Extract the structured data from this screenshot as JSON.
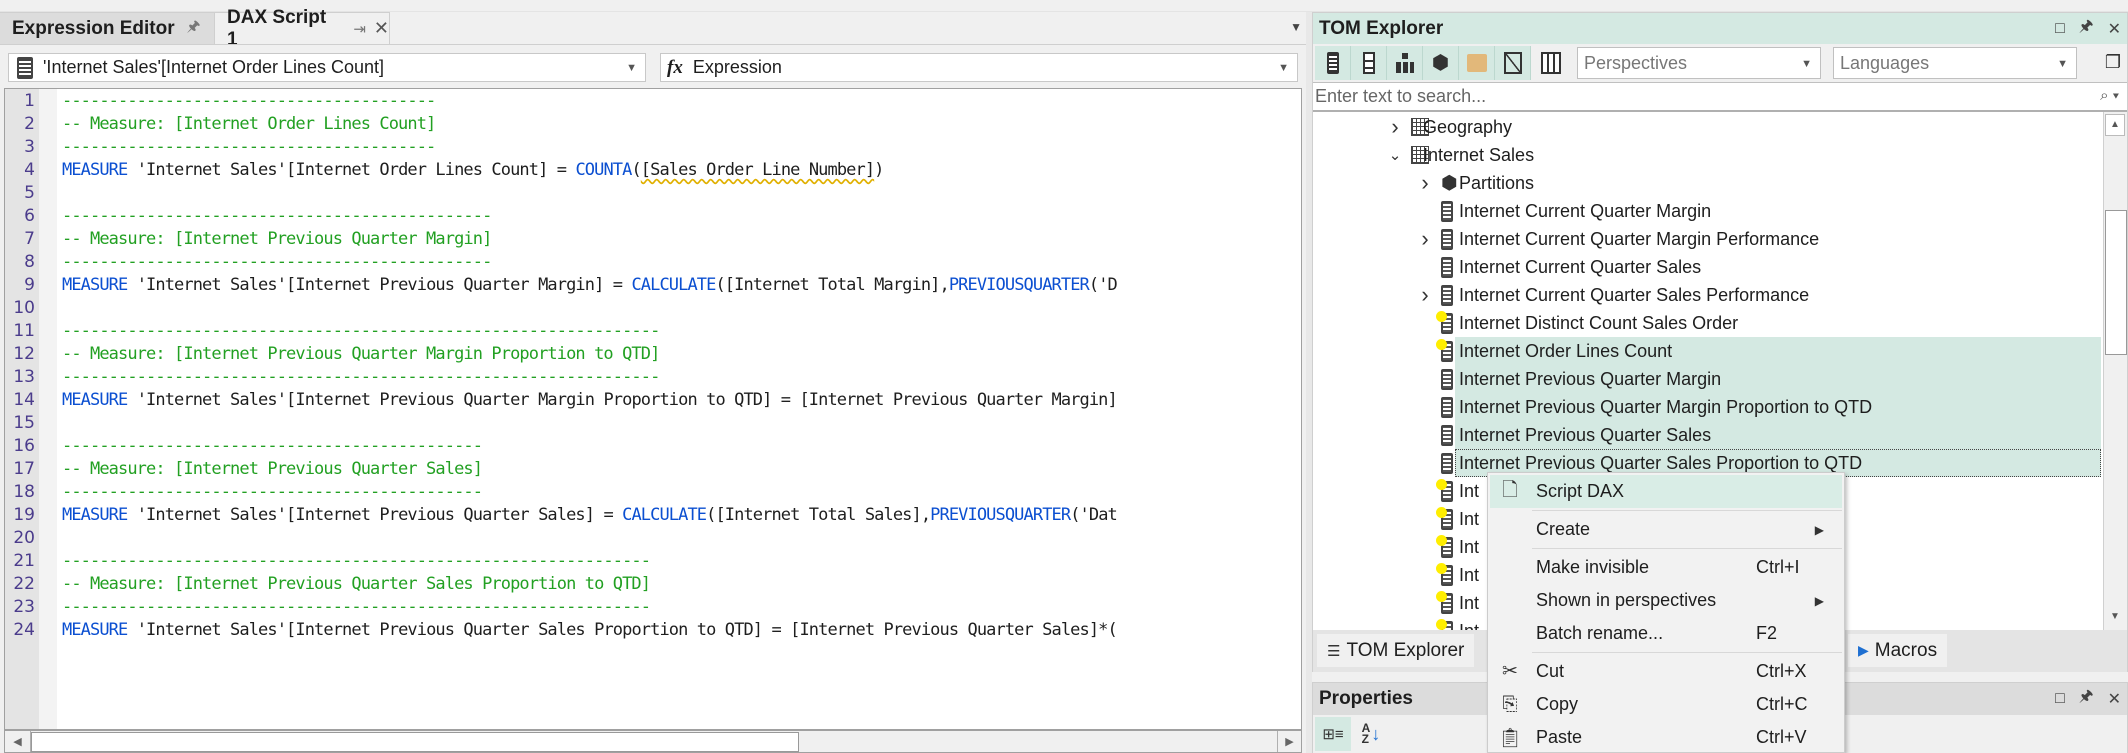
{
  "document_tabs": [
    {
      "label": "Expression Editor",
      "active": false,
      "pin_icon": "pin-icon"
    },
    {
      "label": "DAX Script 1",
      "active": true,
      "pin_icon": "pin-sideways-icon",
      "close_icon": "close-icon"
    }
  ],
  "selectors": {
    "object": "'Internet Sales'[Internet Order Lines Count]",
    "property_icon": "fx",
    "property": "Expression"
  },
  "code": {
    "lines": [
      {
        "n": "1",
        "parts": [
          {
            "t": "----------------------------------------",
            "c": "comment"
          }
        ]
      },
      {
        "n": "2",
        "parts": [
          {
            "t": "-- Measure: [Internet Order Lines Count]",
            "c": "comment"
          }
        ]
      },
      {
        "n": "3",
        "parts": [
          {
            "t": "----------------------------------------",
            "c": "comment"
          }
        ]
      },
      {
        "n": "4",
        "parts": [
          {
            "t": "MEASURE",
            "c": "kw"
          },
          {
            "t": " 'Internet Sales'[Internet Order Lines Count] = ",
            "c": ""
          },
          {
            "t": "COUNTA",
            "c": "fn"
          },
          {
            "t": "(",
            "c": ""
          },
          {
            "t": "[Sales Order Line Number]",
            "c": "squig"
          },
          {
            "t": ")",
            "c": ""
          }
        ]
      },
      {
        "n": "5",
        "parts": []
      },
      {
        "n": "6",
        "parts": [
          {
            "t": "----------------------------------------------",
            "c": "comment"
          }
        ]
      },
      {
        "n": "7",
        "parts": [
          {
            "t": "-- Measure: [Internet Previous Quarter Margin]",
            "c": "comment"
          }
        ]
      },
      {
        "n": "8",
        "parts": [
          {
            "t": "----------------------------------------------",
            "c": "comment"
          }
        ]
      },
      {
        "n": "9",
        "parts": [
          {
            "t": "MEASURE",
            "c": "kw"
          },
          {
            "t": " 'Internet Sales'[Internet Previous Quarter Margin] = ",
            "c": ""
          },
          {
            "t": "CALCULATE",
            "c": "fn"
          },
          {
            "t": "([Internet Total Margin],",
            "c": ""
          },
          {
            "t": "PREVIOUSQUARTER",
            "c": "fn"
          },
          {
            "t": "('D",
            "c": ""
          }
        ]
      },
      {
        "n": "10",
        "parts": []
      },
      {
        "n": "11",
        "parts": [
          {
            "t": "----------------------------------------------------------------",
            "c": "comment"
          }
        ]
      },
      {
        "n": "12",
        "parts": [
          {
            "t": "-- Measure: [Internet Previous Quarter Margin Proportion to QTD]",
            "c": "comment"
          }
        ]
      },
      {
        "n": "13",
        "parts": [
          {
            "t": "----------------------------------------------------------------",
            "c": "comment"
          }
        ]
      },
      {
        "n": "14",
        "parts": [
          {
            "t": "MEASURE",
            "c": "kw"
          },
          {
            "t": " 'Internet Sales'[Internet Previous Quarter Margin Proportion to QTD] = [Internet Previous Quarter Margin]",
            "c": ""
          }
        ]
      },
      {
        "n": "15",
        "parts": []
      },
      {
        "n": "16",
        "parts": [
          {
            "t": "---------------------------------------------",
            "c": "comment"
          }
        ]
      },
      {
        "n": "17",
        "parts": [
          {
            "t": "-- Measure: [Internet Previous Quarter Sales]",
            "c": "comment"
          }
        ]
      },
      {
        "n": "18",
        "parts": [
          {
            "t": "---------------------------------------------",
            "c": "comment"
          }
        ]
      },
      {
        "n": "19",
        "parts": [
          {
            "t": "MEASURE",
            "c": "kw"
          },
          {
            "t": " 'Internet Sales'[Internet Previous Quarter Sales] = ",
            "c": ""
          },
          {
            "t": "CALCULATE",
            "c": "fn"
          },
          {
            "t": "([Internet Total Sales],",
            "c": ""
          },
          {
            "t": "PREVIOUSQUARTER",
            "c": "fn"
          },
          {
            "t": "('Dat",
            "c": ""
          }
        ]
      },
      {
        "n": "20",
        "parts": []
      },
      {
        "n": "21",
        "parts": [
          {
            "t": "---------------------------------------------------------------",
            "c": "comment"
          }
        ]
      },
      {
        "n": "22",
        "parts": [
          {
            "t": "-- Measure: [Internet Previous Quarter Sales Proportion to QTD]",
            "c": "comment"
          }
        ]
      },
      {
        "n": "23",
        "parts": [
          {
            "t": "---------------------------------------------------------------",
            "c": "comment"
          }
        ]
      },
      {
        "n": "24",
        "parts": [
          {
            "t": "MEASURE",
            "c": "kw"
          },
          {
            "t": " 'Internet Sales'[Internet Previous Quarter Sales Proportion to QTD] = [Internet Previous Quarter Sales]*(",
            "c": ""
          }
        ]
      }
    ]
  },
  "tom_explorer": {
    "title": "TOM Explorer",
    "window_controls": [
      "maximize-icon",
      "pin-icon",
      "close-icon"
    ],
    "toolbar_buttons": [
      {
        "name": "show-measures",
        "icon": "calculator-icon",
        "on": true
      },
      {
        "name": "show-columns",
        "icon": "column-icon",
        "on": true
      },
      {
        "name": "show-hierarchies",
        "icon": "hierarchy-icon",
        "on": true
      },
      {
        "name": "show-partitions",
        "icon": "cube-icon",
        "on": true
      },
      {
        "name": "display-folders",
        "icon": "folder-icon",
        "on": true
      },
      {
        "name": "show-hidden",
        "icon": "hidden-icon",
        "on": true
      },
      {
        "name": "show-all-columns",
        "icon": "columns-icon",
        "on": false
      }
    ],
    "perspectives_placeholder": "Perspectives",
    "languages_placeholder": "Languages",
    "search_placeholder": "Enter text to search...",
    "tree": [
      {
        "label": "Geography",
        "level": 0,
        "icon": "table",
        "chevron": "collapsed"
      },
      {
        "label": "Internet Sales",
        "level": 0,
        "icon": "table",
        "chevron": "expanded"
      },
      {
        "label": "Partitions",
        "level": 1,
        "icon": "partition",
        "chevron": "collapsed"
      },
      {
        "label": "Internet Current Quarter Margin",
        "level": 1,
        "icon": "measure",
        "chevron": "none"
      },
      {
        "label": "Internet Current Quarter Margin Performance",
        "level": 1,
        "icon": "measure",
        "chevron": "collapsed"
      },
      {
        "label": "Internet Current Quarter Sales",
        "level": 1,
        "icon": "measure",
        "chevron": "none"
      },
      {
        "label": "Internet Current Quarter Sales Performance",
        "level": 1,
        "icon": "measure",
        "chevron": "collapsed"
      },
      {
        "label": "Internet Distinct Count Sales Order",
        "level": 1,
        "icon": "measure",
        "chevron": "none",
        "warning": true
      },
      {
        "label": "Internet Order Lines Count",
        "level": 1,
        "icon": "measure",
        "chevron": "none",
        "warning": true,
        "selected": true
      },
      {
        "label": "Internet Previous Quarter Margin",
        "level": 1,
        "icon": "measure",
        "chevron": "none",
        "selected": true
      },
      {
        "label": "Internet Previous Quarter Margin Proportion to QTD",
        "level": 1,
        "icon": "measure",
        "chevron": "none",
        "selected": true
      },
      {
        "label": "Internet Previous Quarter Sales",
        "level": 1,
        "icon": "measure",
        "chevron": "none",
        "selected": true
      },
      {
        "label": "Internet Previous Quarter Sales Proportion to QTD",
        "level": 1,
        "icon": "measure",
        "chevron": "none",
        "selected": true,
        "focused": true
      },
      {
        "label": "Int",
        "level": 1,
        "icon": "measure",
        "chevron": "none",
        "warning": true
      },
      {
        "label": "Int",
        "level": 1,
        "icon": "measure",
        "chevron": "none",
        "warning": true
      },
      {
        "label": "Int",
        "level": 1,
        "icon": "measure",
        "chevron": "none",
        "warning": true
      },
      {
        "label": "Int",
        "level": 1,
        "icon": "measure",
        "chevron": "none",
        "warning": true
      },
      {
        "label": "Int",
        "level": 1,
        "icon": "measure",
        "chevron": "none",
        "warning": true
      },
      {
        "label": "Int",
        "level": 1,
        "icon": "measure",
        "chevron": "none",
        "warning": true
      }
    ],
    "bottom_tabs": [
      {
        "label": "TOM Explorer",
        "icon": "tree-list-icon"
      },
      {
        "label": "Macros",
        "icon": "macro-play-icon"
      }
    ]
  },
  "properties": {
    "title": "Properties",
    "window_controls": [
      "maximize-icon",
      "pin-icon",
      "close-icon"
    ],
    "toolbar": [
      "categorized-icon",
      "sort-alphabetical-icon"
    ]
  },
  "context_menu": {
    "items": [
      {
        "label": "Script DAX",
        "icon": "script-icon",
        "shortcut": "",
        "submenu": false,
        "highlighted": true
      },
      {
        "sep": true
      },
      {
        "label": "Create",
        "icon": "",
        "shortcut": "",
        "submenu": true
      },
      {
        "sep": true
      },
      {
        "label": "Make invisible",
        "icon": "",
        "shortcut": "Ctrl+I",
        "submenu": false
      },
      {
        "label": "Shown in perspectives",
        "icon": "",
        "shortcut": "",
        "submenu": true
      },
      {
        "label": "Batch rename...",
        "icon": "",
        "shortcut": "F2",
        "submenu": false
      },
      {
        "sep": true
      },
      {
        "label": "Cut",
        "icon": "scissors-icon",
        "shortcut": "Ctrl+X",
        "submenu": false
      },
      {
        "label": "Copy",
        "icon": "copy-icon",
        "shortcut": "Ctrl+C",
        "submenu": false
      },
      {
        "label": "Paste",
        "icon": "paste-icon",
        "shortcut": "Ctrl+V",
        "submenu": false
      }
    ]
  }
}
